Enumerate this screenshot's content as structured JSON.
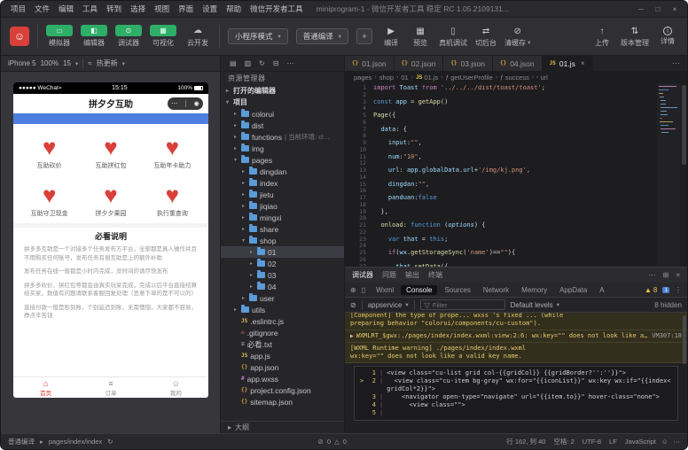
{
  "window": {
    "menu_items": [
      "项目",
      "文件",
      "编辑",
      "工具",
      "转到",
      "选择",
      "视图",
      "界面",
      "设置",
      "帮助",
      "微信开发者工具"
    ],
    "title": "miniprogram-1 - 微信开发者工具 稳定 RC 1.05.2109131...",
    "controls": [
      {
        "name": "minimize-button",
        "glyph": "─"
      },
      {
        "name": "maximize-button",
        "glyph": "□"
      },
      {
        "name": "close-button",
        "glyph": "×"
      }
    ]
  },
  "glyphs": {
    "avatar": "☺",
    "caret": "▾",
    "collapsed": "▸",
    "more": "⋯",
    "kebab": "⋮",
    "clear": "⊘",
    "filter": "▽",
    "expand": "▶",
    "warn": "▲",
    "wtri": "△",
    "inspect": "⊕",
    "device": "▯",
    "refresh": "↻",
    "smiley": "☺",
    "wifi": "≈",
    "heart": "♥",
    "crumb_sep": "›"
  },
  "toolbar": {
    "toggles": [
      {
        "label": "模拟器",
        "glyph": "▭"
      },
      {
        "label": "编辑器",
        "glyph": "◧"
      },
      {
        "label": "调试器",
        "glyph": "⊙"
      },
      {
        "label": "可视化",
        "glyph": "▦"
      },
      {
        "label": "云开发",
        "glyph": "☁"
      }
    ],
    "mode_select": "小程序模式",
    "compile_select": "普通编译",
    "add_button": "+",
    "actions": [
      {
        "label": "编译",
        "glyph": "▶"
      },
      {
        "label": "预览",
        "glyph": "▦"
      },
      {
        "label": "真机调试",
        "glyph": "▯"
      },
      {
        "label": "切后台",
        "glyph": "⇄"
      },
      {
        "label": "清缓存",
        "glyph": "⊘",
        "caret": "▾"
      }
    ],
    "right_actions": [
      {
        "label": "上传",
        "glyph": "↑"
      },
      {
        "label": "版本管理",
        "glyph": "⇅"
      },
      {
        "label": "详情",
        "glyph": "i",
        "circle": true
      }
    ]
  },
  "simulator": {
    "device": "iPhone 5",
    "zoom": "100%",
    "scale": "15",
    "hot_reload": "热更新"
  },
  "phone": {
    "status": {
      "carrier": "●●●●● WeChat",
      "time": "15:15",
      "battery": "100%"
    },
    "nav_title": "拼夕夕互助",
    "capsule": {
      "more": "⋯",
      "exit": "◉"
    },
    "grid": [
      {
        "label": "互助砍价"
      },
      {
        "label": "互助拼红包"
      },
      {
        "label": "互助年卡助力"
      },
      {
        "label": "互助守卫现金"
      },
      {
        "label": "拼夕夕果园"
      },
      {
        "label": "执行重查询"
      }
    ],
    "notice_title": "必看说明",
    "paragraphs": [
      "拼多多互助是一个对接多个任务发布方平台，全部都是真人操作并且不用购买任何账号，发布任务有偿互助是上的额外补助",
      "发布任务在线一般都是小时内完成，没时间的请尽快发布",
      "拼多多砍价、拼红包等都会由真实玩家完成，完成以后平台直接结算给买家，数值有问题请联系客服回复处理（恶意下单的是不可以的）",
      "直接付款一般是秒到账，个别延迟到账，无需懊恼，大家都不容易，挣点辛苦钱"
    ],
    "tabbar": [
      {
        "label": "首页",
        "glyph": "⌂",
        "icon_name": "home-icon",
        "active": true
      },
      {
        "label": "订单",
        "glyph": "≡",
        "icon_name": "orders-icon"
      },
      {
        "label": "我的",
        "glyph": "☺",
        "icon_name": "profile-icon"
      }
    ]
  },
  "explorer": {
    "title": "资源管理器",
    "outline_label": "大纲",
    "toolbar_icons": [
      {
        "name": "new-file-icon",
        "glyph": "▤"
      },
      {
        "name": "new-folder-icon",
        "glyph": "▥"
      },
      {
        "name": "refresh-icon",
        "glyph": "↻"
      },
      {
        "name": "collapse-all-icon",
        "glyph": "⊟"
      },
      {
        "name": "more-icon",
        "glyph": "⋯"
      }
    ],
    "icon_glyphs": {
      "js": "JS",
      "json": "{}",
      "txt": "≡",
      "git": "◇",
      "wxss": "#"
    },
    "tree": [
      {
        "indent": 0,
        "arrow": "▸",
        "label": "打开的编辑器",
        "section": true
      },
      {
        "indent": 0,
        "arrow": "▾",
        "label": "项目",
        "section": true
      },
      {
        "indent": 1,
        "arrow": "▸",
        "icon": "folder",
        "label": "colorui"
      },
      {
        "indent": 1,
        "arrow": "▸",
        "icon": "folder",
        "label": "dist"
      },
      {
        "indent": 1,
        "arrow": "▸",
        "icon": "folder",
        "label": "functions",
        "extra": "| 当前环境: cl…"
      },
      {
        "indent": 1,
        "arrow": "▸",
        "icon": "folder",
        "label": "img"
      },
      {
        "indent": 1,
        "arrow": "▾",
        "icon": "folder",
        "label": "pages"
      },
      {
        "indent": 2,
        "arrow": "▸",
        "icon": "folder",
        "label": "dingdan"
      },
      {
        "indent": 2,
        "arrow": "▸",
        "icon": "folder",
        "label": "index"
      },
      {
        "indent": 2,
        "arrow": "▸",
        "icon": "folder",
        "label": "jietu"
      },
      {
        "indent": 2,
        "arrow": "▸",
        "icon": "folder",
        "label": "jiqiao"
      },
      {
        "indent": 2,
        "arrow": "▸",
        "icon": "folder",
        "label": "mingxi"
      },
      {
        "indent": 2,
        "arrow": "▸",
        "icon": "folder",
        "label": "share"
      },
      {
        "indent": 2,
        "arrow": "▾",
        "icon": "folder",
        "label": "shop"
      },
      {
        "indent": 3,
        "arrow": "▸",
        "icon": "folder",
        "label": "01",
        "selected": true
      },
      {
        "indent": 3,
        "arrow": "▸",
        "icon": "folder",
        "label": "02"
      },
      {
        "indent": 3,
        "arrow": "▸",
        "icon": "folder",
        "label": "03"
      },
      {
        "indent": 3,
        "arrow": "▸",
        "icon": "folder",
        "label": "04"
      },
      {
        "indent": 2,
        "arrow": "▸",
        "icon": "folder",
        "label": "user"
      },
      {
        "indent": 1,
        "arrow": "▸",
        "icon": "folder",
        "label": "utils"
      },
      {
        "indent": 1,
        "icon": "js",
        "label": ".eslintrc.js"
      },
      {
        "indent": 1,
        "icon": "git",
        "label": ".gitignore"
      },
      {
        "indent": 1,
        "icon": "txt",
        "label": "必看.txt"
      },
      {
        "indent": 1,
        "icon": "js",
        "label": "app.js"
      },
      {
        "indent": 1,
        "icon": "json",
        "label": "app.json"
      },
      {
        "indent": 1,
        "icon": "wxss",
        "label": "app.wxss"
      },
      {
        "indent": 1,
        "icon": "json",
        "label": "project.config.json"
      },
      {
        "indent": 1,
        "icon": "json",
        "label": "sitemap.json"
      }
    ]
  },
  "editor": {
    "tabs": [
      {
        "icon": "json",
        "label": "01.json"
      },
      {
        "icon": "json",
        "label": "02.json"
      },
      {
        "icon": "json",
        "label": "03.json"
      },
      {
        "icon": "json",
        "label": "04.json"
      },
      {
        "icon": "js",
        "label": "01.js",
        "active": true
      }
    ],
    "breadcrumb": [
      {
        "label": "pages"
      },
      {
        "label": "shop"
      },
      {
        "label": "01"
      },
      {
        "icon": "JS",
        "label": "01.js"
      },
      {
        "icon": "ƒ",
        "label": "getUserProfile"
      },
      {
        "icon": "ƒ",
        "label": "success"
      },
      {
        "icon": "◦",
        "label": "url"
      }
    ],
    "lines": [
      [
        [
          "k",
          "import"
        ],
        [
          "p",
          " "
        ],
        [
          "v",
          "Toast"
        ],
        [
          "p",
          " "
        ],
        [
          "k",
          "from"
        ],
        [
          "p",
          " "
        ],
        [
          "s",
          "'../../../dist/toast/toast'"
        ],
        [
          "p",
          ";"
        ]
      ],
      null,
      [
        [
          "d",
          "const"
        ],
        [
          "p",
          " "
        ],
        [
          "v",
          "app"
        ],
        [
          "p",
          " = "
        ],
        [
          "f",
          "getApp"
        ],
        [
          "p",
          "()"
        ]
      ],
      null,
      [
        [
          "f",
          "Page"
        ],
        [
          "p",
          "({"
        ]
      ],
      null,
      [
        [
          "p",
          "  "
        ],
        [
          "v",
          "data"
        ],
        [
          "p",
          ": {"
        ]
      ],
      null,
      [
        [
          "p",
          "    "
        ],
        [
          "v",
          "input"
        ],
        [
          "p",
          ":"
        ],
        [
          "s",
          "\"\""
        ],
        [
          "p",
          ","
        ]
      ],
      null,
      [
        [
          "p",
          "    "
        ],
        [
          "v",
          "num"
        ],
        [
          "p",
          ":"
        ],
        [
          "s",
          "\"10\""
        ],
        [
          "p",
          ","
        ]
      ],
      null,
      [
        [
          "p",
          "    "
        ],
        [
          "v",
          "url"
        ],
        [
          "p",
          ": "
        ],
        [
          "v",
          "app"
        ],
        [
          "p",
          "."
        ],
        [
          "v",
          "globalData"
        ],
        [
          "p",
          "."
        ],
        [
          "v",
          "url"
        ],
        [
          "p",
          "+"
        ],
        [
          "s",
          "'/img/kj.png'"
        ],
        [
          "p",
          ","
        ]
      ],
      null,
      [
        [
          "p",
          "    "
        ],
        [
          "v",
          "dingdan"
        ],
        [
          "p",
          ":"
        ],
        [
          "s",
          "\"\""
        ],
        [
          "p",
          ","
        ]
      ],
      null,
      [
        [
          "p",
          "    "
        ],
        [
          "v",
          "panduan"
        ],
        [
          "p",
          ":"
        ],
        [
          "d",
          "false"
        ]
      ],
      null,
      [
        [
          "p",
          "  },"
        ]
      ],
      null,
      [
        [
          "p",
          "  "
        ],
        [
          "f",
          "onload"
        ],
        [
          "p",
          ": "
        ],
        [
          "d",
          "function"
        ],
        [
          "p",
          " ("
        ],
        [
          "m",
          "options"
        ],
        [
          "p",
          ") {"
        ]
      ],
      null,
      [
        [
          "p",
          "    "
        ],
        [
          "d",
          "var"
        ],
        [
          "p",
          " "
        ],
        [
          "v",
          "that"
        ],
        [
          "p",
          " = "
        ],
        [
          "d",
          "this"
        ],
        [
          "p",
          ";"
        ]
      ],
      null,
      [
        [
          "p",
          "    "
        ],
        [
          "k",
          "if"
        ],
        [
          "p",
          "("
        ],
        [
          "v",
          "wx"
        ],
        [
          "p",
          "."
        ],
        [
          "f",
          "getStorageSync"
        ],
        [
          "p",
          "("
        ],
        [
          "s",
          "'name'"
        ],
        [
          "p",
          ")=="
        ],
        [
          "s",
          "\"\""
        ],
        [
          "p",
          "){"
        ]
      ],
      null,
      [
        [
          "p",
          "      "
        ],
        [
          "v",
          "that"
        ],
        [
          "p",
          "."
        ],
        [
          "f",
          "setData"
        ],
        [
          "p",
          "({"
        ]
      ]
    ]
  },
  "debugger": {
    "panel_tabs": [
      "调试器",
      "问题",
      "输出",
      "终端"
    ],
    "header_icons": [
      {
        "name": "more-icon",
        "glyph": "⋯"
      },
      {
        "name": "undock-icon",
        "glyph": "⊞"
      },
      {
        "name": "close-icon",
        "glyph": "×"
      }
    ],
    "devtools_tabs": [
      "Wxml",
      "Console",
      "Sources",
      "Network",
      "Memory",
      "AppData",
      "A"
    ],
    "active_tab": "Console"
  },
  "console": {
    "context": "appservice",
    "filter_placeholder": "Filter",
    "levels": "Default levels",
    "hidden": "8 hidden",
    "warn_count": "8",
    "info_count": "1",
    "m1_line1": "[Component] the type of prope...  wxss 's fixed ... (while",
    "m1_line2": "preparing behavior \"colorui/components/cu-custom\").",
    "m2_text": "WXMLRT_$gwx:./pages/index/index.wxml:view:2:6: wx:key=\"\" does not look like a valid key name.",
    "m2_source": "VM307:18",
    "m3_line1": "[WXML Runtime warning] ./pages/index/index.wxml",
    "m3_line2": "wx:key=\"\" does not look like a valid key name.",
    "code_lines": [
      {
        "n": "1",
        "m": "",
        "t": "<view class=\"cu-list grid col-{{gridCol}} {{gridBorder?'':''}}\">"
      },
      {
        "n": "2",
        "m": ">",
        "t": "  <view class=\"cu-item bg-gray\" wx:for=\"{{iconList}}\" wx:key wx:if=\"{{index<gridCol*2}}\">"
      },
      {
        "n": "3",
        "m": "",
        "t": "    <navigator open-type=\"navigate\" url=\"{{item.to}}\" hover-class=\"none\">"
      },
      {
        "n": "4",
        "m": "",
        "t": "      <view class=\"\">"
      },
      {
        "n": "5",
        "m": "",
        "t": ""
      }
    ]
  },
  "statusbar": {
    "mode": "普通编译",
    "page_path": "pages/index/index",
    "errors": "0",
    "warnings": "0",
    "right_items": [
      "行 162, 列 40",
      "空格: 2",
      "UTF-8",
      "LF",
      "JavaScript"
    ]
  },
  "colors": {
    "wechat_green": "#2fae68",
    "pdd_red": "#d9403a",
    "warning_yellow": "#e6c96e",
    "banner_blue": "#4e7fe0"
  }
}
